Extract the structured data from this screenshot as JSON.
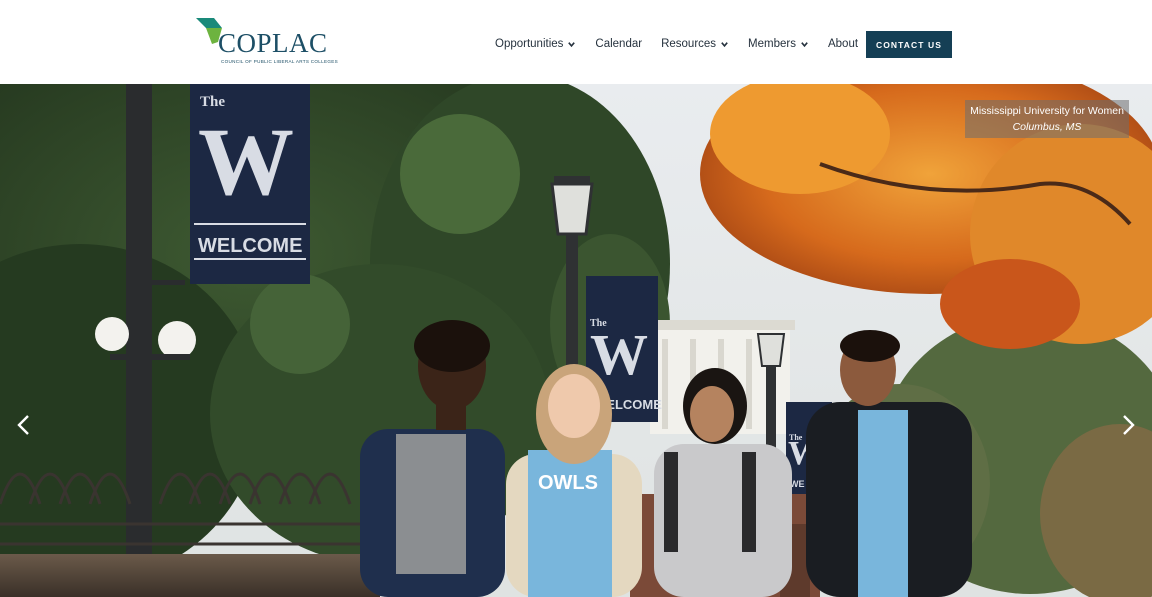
{
  "brand": {
    "name": "COPLAC",
    "tagline": "COUNCIL OF PUBLIC LIBERAL ARTS COLLEGES",
    "colors": {
      "primary": "#1d4f66",
      "accent_green": "#6db33f",
      "accent_teal": "#1a8a7a"
    }
  },
  "nav": {
    "items": [
      {
        "label": "Opportunities",
        "dropdown": true
      },
      {
        "label": "Calendar",
        "dropdown": false
      },
      {
        "label": "Resources",
        "dropdown": true
      },
      {
        "label": "Members",
        "dropdown": true
      },
      {
        "label": "About",
        "dropdown": false
      }
    ],
    "contact_label": "CONTACT US"
  },
  "hero": {
    "caption_school": "Mississippi University for Women",
    "caption_location": "Columbus, MS",
    "banner_large": {
      "the": "The",
      "letter": "W",
      "word": "WELCOME"
    },
    "banner_mid": {
      "the": "The",
      "letter": "W",
      "word": "WELCOME"
    },
    "banner_small": {
      "the": "The",
      "letter": "W",
      "word": "WE"
    },
    "shirt_text": "OWLS",
    "prev_icon": "chevron-left-icon",
    "next_icon": "chevron-right-icon"
  }
}
